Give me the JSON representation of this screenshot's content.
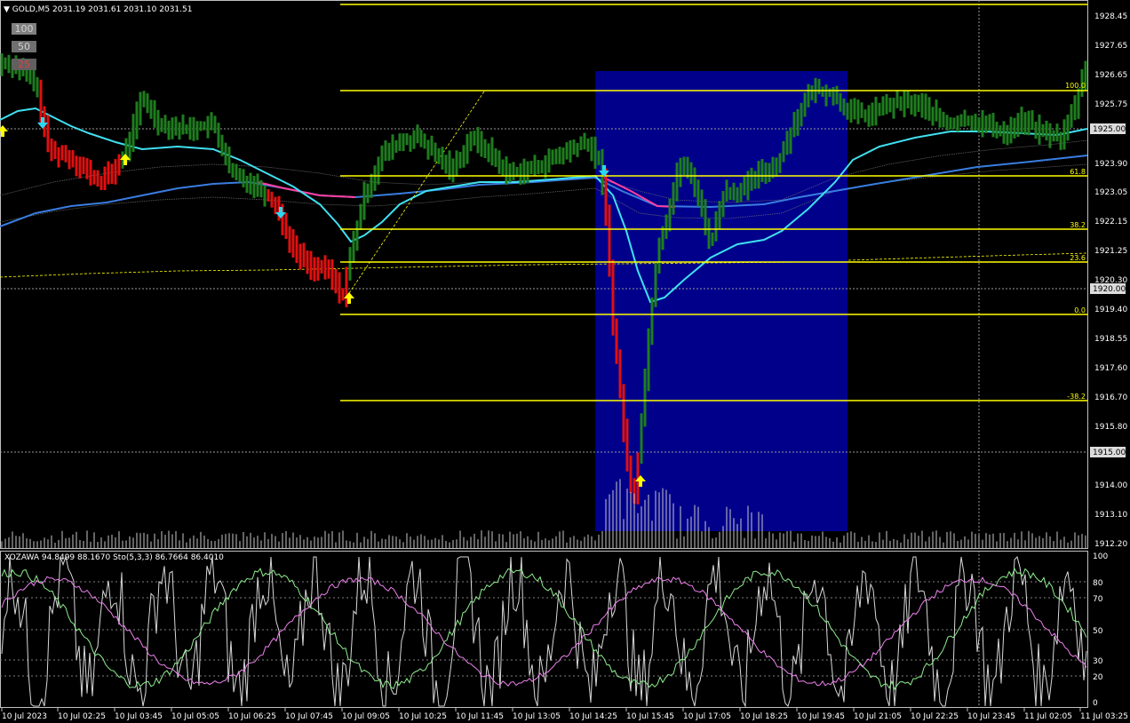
{
  "header": {
    "symbol_info": "GOLD,M5  2031.19 2031.61 2031.10 2031.51"
  },
  "toolbar_buttons": [
    "100",
    "50",
    "25"
  ],
  "price_axis": {
    "labels": [
      "1928.45",
      "1927.65",
      "1926.65",
      "1925.75",
      "1923.90",
      "1923.05",
      "1922.15",
      "1921.25",
      "1920.30",
      "1919.40",
      "1918.55",
      "1917.60",
      "1916.70",
      "1915.80",
      "1914.00",
      "1913.10",
      "1912.20"
    ],
    "markers": [
      "1925.00",
      "1920.00",
      "1915.00"
    ]
  },
  "fibonacci_levels": [
    "100.0",
    "61.8",
    "38.2",
    "23.6",
    "0.0",
    "-38.2"
  ],
  "indicator_header": "XOZAWA 94.8499 88.1670  Sto(5,3,3) 86.7664 86.4010",
  "indicator_axis": [
    "100",
    "80",
    "70",
    "50",
    "30",
    "20",
    "0"
  ],
  "time_axis": [
    "10 Jul 2023",
    "10 Jul 02:25",
    "10 Jul 03:45",
    "10 Jul 05:05",
    "10 Jul 06:25",
    "10 Jul 07:45",
    "10 Jul 09:05",
    "10 Jul 10:25",
    "10 Jul 11:45",
    "10 Jul 13:05",
    "10 Jul 14:25",
    "10 Jul 15:45",
    "10 Jul 17:05",
    "10 Jul 18:25",
    "10 Jul 19:45",
    "10 Jul 21:05",
    "10 Jul 22:25",
    "10 Jul 23:45",
    "11 Jul 02:05",
    "11 Jul 03:25"
  ],
  "colors": {
    "bull": "#1e7d1e",
    "bear": "#e01010",
    "fib": "#ffff00",
    "highlight_box": "#00008b",
    "ma_fast": "#40e0f0",
    "ma_slow": "#3a7de0",
    "ma_mid": "#ff3fa0",
    "arrow_up": "#ffff00",
    "arrow_down": "#28d8f0"
  }
}
